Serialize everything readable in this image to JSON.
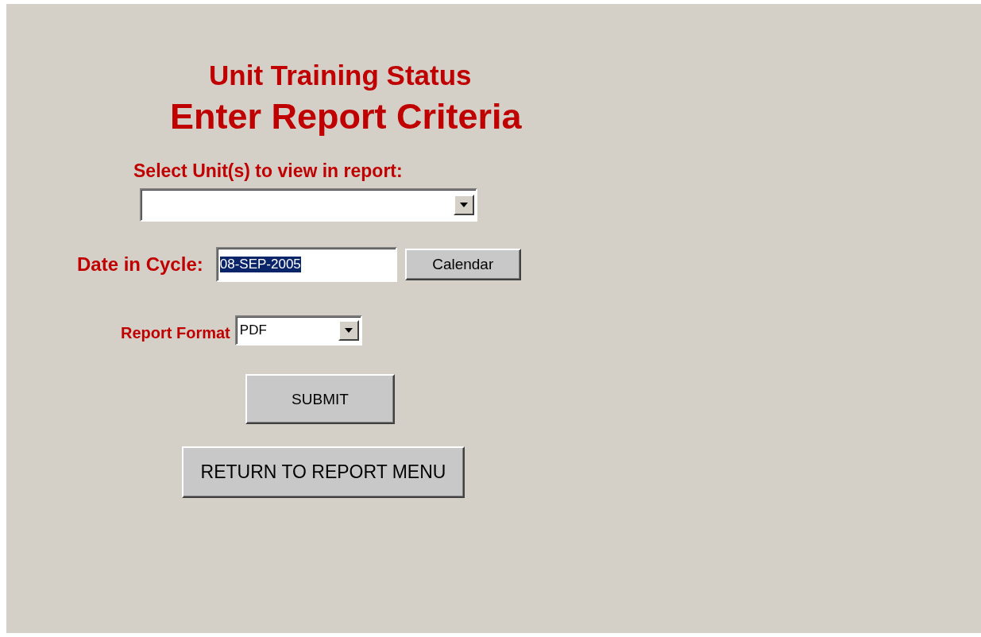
{
  "heading": {
    "title": "Unit Training Status",
    "subtitle": "Enter Report Criteria"
  },
  "unit_select": {
    "label": "Select Unit(s) to view in report:"
  },
  "date_in_cycle": {
    "label": "Date in Cycle:",
    "value": "08-SEP-2005",
    "text_selected": true
  },
  "calendar_button": {
    "label": "Calendar"
  },
  "report_format": {
    "label": "Report Format",
    "value": "PDF"
  },
  "buttons": [
    {
      "label": "SUBMIT",
      "kind": "submit"
    },
    {
      "label": "RETURN TO REPORT MENU",
      "kind": "menu"
    }
  ]
}
